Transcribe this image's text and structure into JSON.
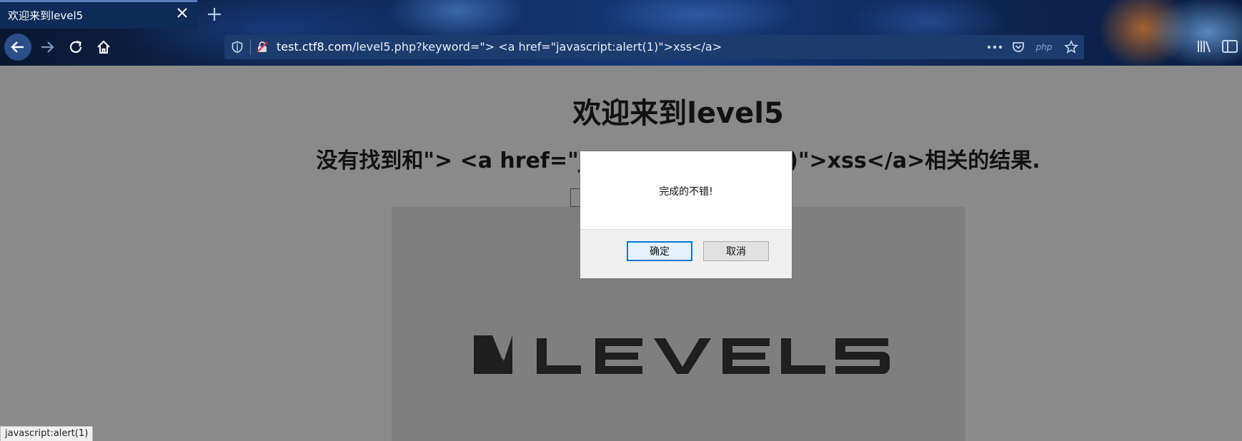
{
  "browser": {
    "tab_title": "欢迎来到level5",
    "url_host": "test.ctf8.com",
    "url_rest": "/level5.php?keyword=\"> <a href=\"javascript:alert(1)\">xss</a>",
    "php_badge": "php",
    "status_text": "javascript:alert(1)"
  },
  "page": {
    "title": "欢迎来到level5",
    "result_text": "没有找到和\"> <a href=\"javascript:alert(1)\">xss</a>相关的结果."
  },
  "dialog": {
    "message": "完成的不错!",
    "ok_label": "确定",
    "cancel_label": "取消"
  },
  "logo": {
    "text": "LEVEL5"
  },
  "icons": {
    "tab_close": "close-icon",
    "new_tab": "plus-icon",
    "back": "arrow-left-icon",
    "forward": "arrow-right-icon",
    "reload": "reload-icon",
    "home": "home-icon",
    "shield": "shield-icon",
    "insecure": "insecure-lock-icon",
    "more": "more-icon",
    "pocket": "pocket-icon",
    "bookmark": "star-icon",
    "library": "library-icon",
    "sidebar": "sidebar-icon"
  }
}
